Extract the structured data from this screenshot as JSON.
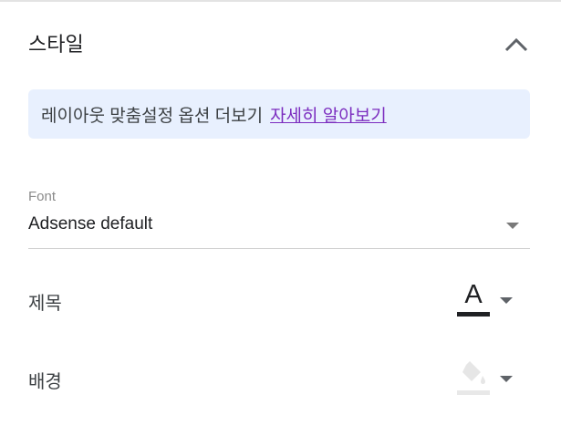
{
  "section": {
    "title": "스타일"
  },
  "banner": {
    "text": "레이아웃 맞춤설정 옵션 더보기",
    "link": "자세히 알아보기"
  },
  "font": {
    "label": "Font",
    "value": "Adsense default"
  },
  "title_color": {
    "label": "제목",
    "glyph": "A",
    "color": "#202124"
  },
  "background_color": {
    "label": "배경",
    "color": "#e8e8e8"
  },
  "colors": {
    "banner_bg": "#e8f0fe",
    "link": "#7b2cbf"
  }
}
